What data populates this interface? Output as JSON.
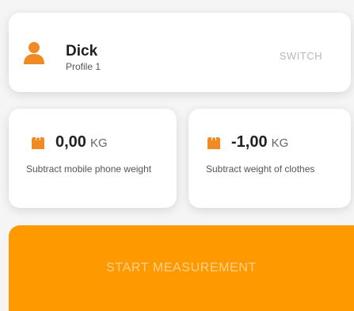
{
  "colors": {
    "accent": "#ff9900",
    "icon": "#f08a24"
  },
  "profile": {
    "icon": "user-icon",
    "name": "Dick",
    "subtitle": "Profile 1",
    "switch_label": "SWITCH"
  },
  "phone_weight": {
    "icon": "weight-icon",
    "value": "0,00",
    "unit": "KG",
    "description": "Subtract mobile phone weight"
  },
  "clothes_weight": {
    "icon": "weight-icon",
    "value": "-1,00",
    "unit": "KG",
    "description": "Subtract weight of clothes"
  },
  "start_button": {
    "label": "START MEASUREMENT"
  }
}
